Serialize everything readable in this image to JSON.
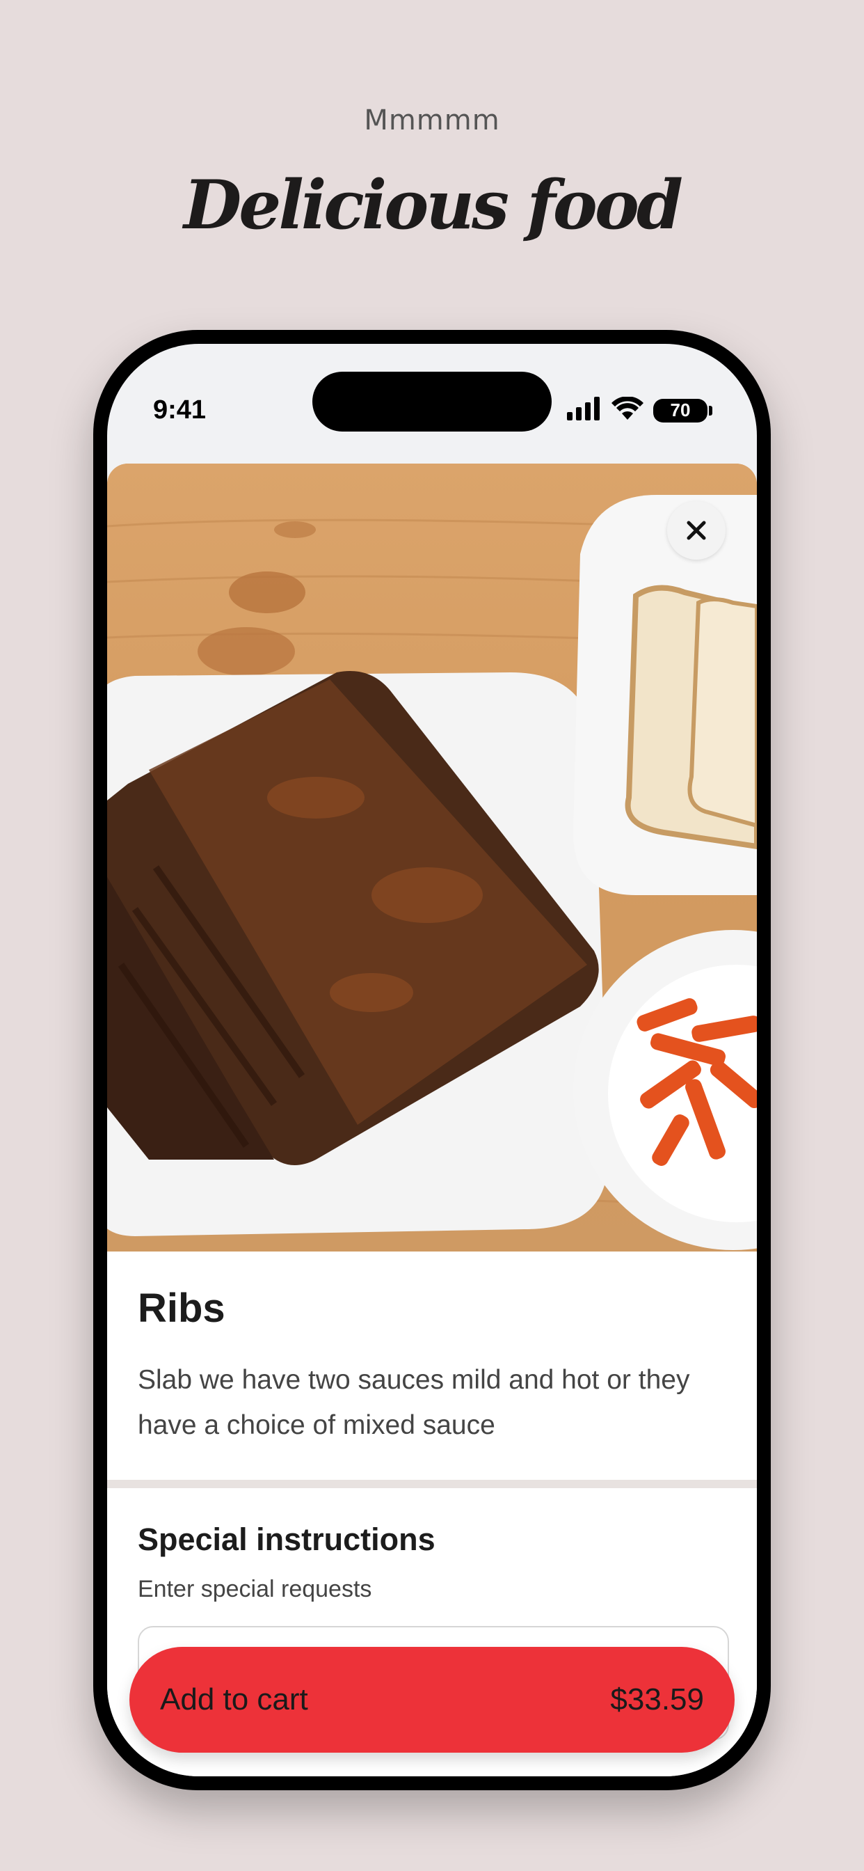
{
  "header": {
    "eyebrow": "Mmmmm",
    "headline": "Delicious food"
  },
  "status_bar": {
    "time": "9:41",
    "battery": "70",
    "icons": [
      "signal-icon",
      "wifi-icon",
      "battery-icon"
    ]
  },
  "item": {
    "title": "Ribs",
    "description": "Slab we have two sauces mild and hot or they have a choice of mixed sauce",
    "close_icon": "close-icon"
  },
  "special_instructions": {
    "title": "Special instructions",
    "subtitle": "Enter special requests",
    "value": ""
  },
  "cart": {
    "label": "Add to cart",
    "price": "$33.59"
  },
  "colors": {
    "background": "#e6dcdc",
    "accent": "#ed3239"
  }
}
